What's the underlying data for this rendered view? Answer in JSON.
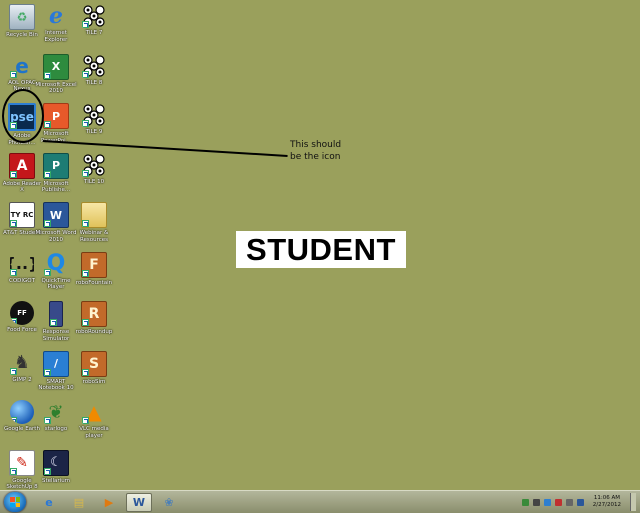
{
  "desktop": {
    "icons": [
      {
        "label": "Recycle Bin",
        "icon": "recycle-bin-icon",
        "symbol": "♻"
      },
      {
        "label": "Internet Explorer",
        "icon": "internet-explorer-icon",
        "symbol": "e"
      },
      {
        "label": "TILE 7",
        "icon": "tile-puzzle-icon",
        "symbol": ""
      },
      {
        "label": "AOL OPAC Nexus",
        "icon": "aol-opac-icon",
        "symbol": "e"
      },
      {
        "label": "Microsoft Excel 2010",
        "icon": "excel-icon",
        "symbol": "X"
      },
      {
        "label": "TILE 8",
        "icon": "tile-puzzle-icon",
        "symbol": ""
      },
      {
        "label": "Adobe Photosh...",
        "icon": "photoshop-elements-icon",
        "symbol": "pse"
      },
      {
        "label": "Microsoft PowerPoi...",
        "icon": "powerpoint-icon",
        "symbol": "P"
      },
      {
        "label": "TILE 9",
        "icon": "tile-puzzle-icon",
        "symbol": ""
      },
      {
        "label": "Adobe Reader X",
        "icon": "adobe-reader-icon",
        "symbol": "A"
      },
      {
        "label": "Microsoft Publishe...",
        "icon": "publisher-icon",
        "symbol": "P"
      },
      {
        "label": "TILE 10",
        "icon": "tile-puzzle-icon",
        "symbol": ""
      },
      {
        "label": "AT&T Student",
        "icon": "att-student-icon",
        "symbol": "TY RC"
      },
      {
        "label": "Microsoft Word 2010",
        "icon": "word-icon",
        "symbol": "W"
      },
      {
        "label": "Webinar & Resources",
        "icon": "folder-icon",
        "symbol": ""
      },
      {
        "label": "CODIGOT",
        "icon": "code-braces-icon",
        "symbol": "{..}"
      },
      {
        "label": "QuickTime Player",
        "icon": "quicktime-icon",
        "symbol": "Q"
      },
      {
        "label": "roboFountain",
        "icon": "robofountain-icon",
        "symbol": "F"
      },
      {
        "label": "Food Force",
        "icon": "food-force-icon",
        "symbol": "FF"
      },
      {
        "label": "Response Simulator",
        "icon": "response-simulator-icon",
        "symbol": ""
      },
      {
        "label": "roboRoundup",
        "icon": "roboroundup-icon",
        "symbol": "R"
      },
      {
        "label": "GIMP 2",
        "icon": "gimp-icon",
        "symbol": "♞"
      },
      {
        "label": "SMART Notebook 10",
        "icon": "smart-notebook-icon",
        "symbol": "/"
      },
      {
        "label": "roboSim",
        "icon": "robosim-icon",
        "symbol": "S"
      },
      {
        "label": "Google Earth",
        "icon": "google-earth-icon",
        "symbol": ""
      },
      {
        "label": "starlogo",
        "icon": "starlogo-icon",
        "symbol": "❦"
      },
      {
        "label": "VLC media player",
        "icon": "vlc-icon",
        "symbol": "▲"
      },
      {
        "label": "Google SketchUp 8",
        "icon": "sketchup-icon",
        "symbol": "✎"
      },
      {
        "label": "Stellarium",
        "icon": "stellarium-icon",
        "symbol": "☾"
      }
    ]
  },
  "annotation": {
    "text_line1": "This should",
    "text_line2": "be the icon"
  },
  "watermark": {
    "text": "STUDENT"
  },
  "taskbar": {
    "pinned": [
      {
        "name": "internet-explorer-icon",
        "symbol": "e",
        "color": "#2a78d8",
        "active": false
      },
      {
        "name": "folder-icon",
        "symbol": "▤",
        "color": "#d8b84a",
        "active": false
      },
      {
        "name": "media-player-icon",
        "symbol": "▶",
        "color": "#e07a10",
        "active": false
      },
      {
        "name": "word-icon",
        "symbol": "W",
        "color": "#2b579a",
        "active": true
      },
      {
        "name": "paint-icon",
        "symbol": "❀",
        "color": "#4a7fb8",
        "active": false
      }
    ],
    "tray_colors": [
      "#3a8a3a",
      "#444444",
      "#2f7fd0",
      "#c03030",
      "#666666",
      "#2b579a"
    ],
    "clock": {
      "time": "11:06 AM",
      "date": "2/27/2012"
    }
  }
}
